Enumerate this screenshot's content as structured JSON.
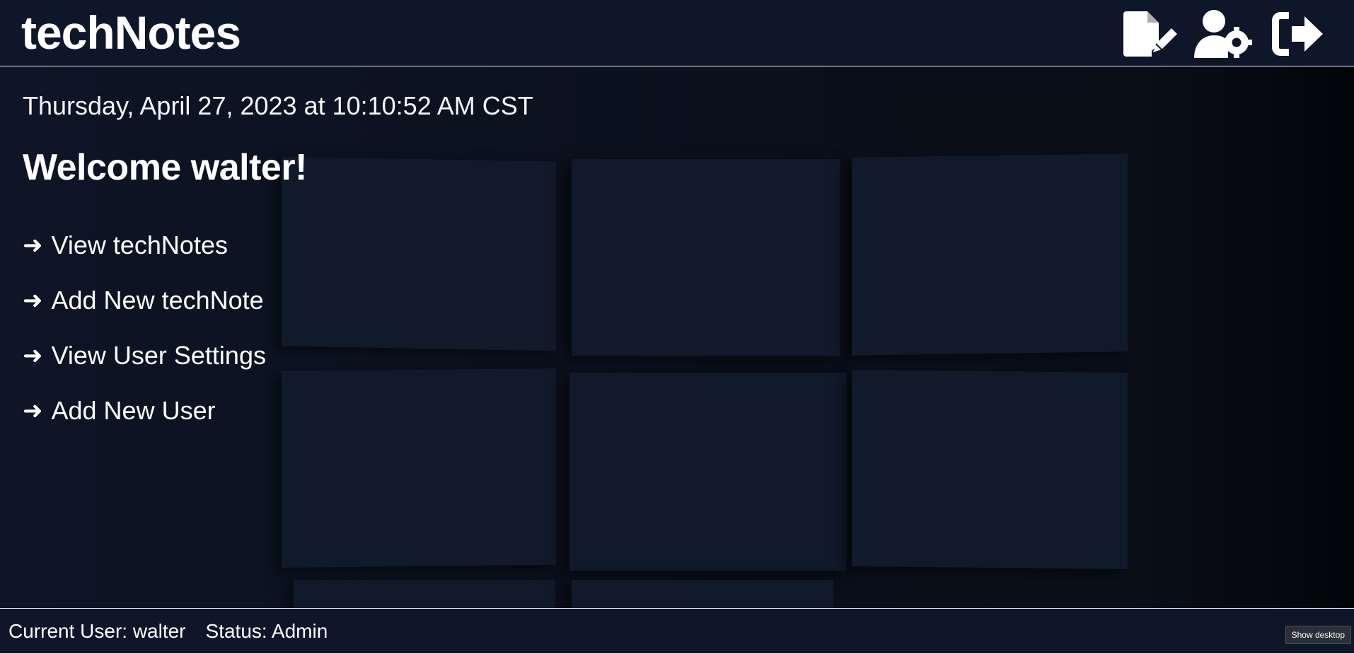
{
  "header": {
    "brand": "techNotes",
    "icons": [
      {
        "name": "new-note-icon"
      },
      {
        "name": "user-settings-icon"
      },
      {
        "name": "logout-icon"
      }
    ]
  },
  "main": {
    "datetime": "Thursday, April 27, 2023 at 10:10:52 AM CST",
    "welcome": "Welcome walter!",
    "arrow": "➜",
    "links": [
      {
        "label": "View techNotes"
      },
      {
        "label": "Add New techNote"
      },
      {
        "label": "View User Settings"
      },
      {
        "label": "Add New User"
      }
    ]
  },
  "footer": {
    "current_user": "Current User: walter",
    "status": "Status: Admin"
  },
  "tooltip": {
    "text": "Show desktop"
  },
  "colors": {
    "background": "#0b1220",
    "header_bg": "#0e1629",
    "text": "#ffffff"
  }
}
